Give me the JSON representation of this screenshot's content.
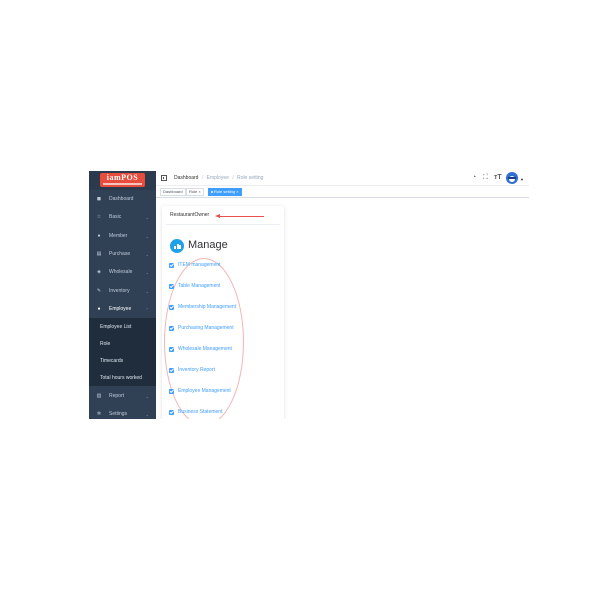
{
  "brand": {
    "logo_text": "iamPOS",
    "logo_color": "#e74c3c"
  },
  "sidebar": {
    "background": "#304156",
    "items": [
      {
        "label": "Dashboard",
        "icon": "dashboard-icon",
        "glyph": "◼",
        "arrow": ""
      },
      {
        "label": "Basic",
        "icon": "star-icon",
        "glyph": "☆",
        "arrow": "⌄"
      },
      {
        "label": "Member",
        "icon": "user-icon",
        "glyph": "●",
        "arrow": "⌄"
      },
      {
        "label": "Purchase",
        "icon": "list-icon",
        "glyph": "▤",
        "arrow": "⌄"
      },
      {
        "label": "Wholesale",
        "icon": "tag-icon",
        "glyph": "◈",
        "arrow": "⌄"
      },
      {
        "label": "Inventory",
        "icon": "edit-icon",
        "glyph": "✎",
        "arrow": "⌄"
      },
      {
        "label": "Employee",
        "icon": "employee-icon",
        "glyph": "●",
        "arrow": "⌃"
      },
      {
        "label": "Report",
        "icon": "chart-icon",
        "glyph": "▥",
        "arrow": "⌄"
      },
      {
        "label": "Settings",
        "icon": "gear-icon",
        "glyph": "✲",
        "arrow": "⌄"
      }
    ],
    "employee_submenu": [
      "Employee List",
      "Role",
      "Timecards",
      "Total hours worked"
    ]
  },
  "navbar": {
    "breadcrumb": [
      "Dashboard",
      "Employee",
      "Role setting"
    ],
    "separator": "/",
    "icons": [
      "help-icon",
      "fullscreen-icon",
      "font-size-icon",
      "avatar"
    ]
  },
  "tags": [
    {
      "label": "Dashboard",
      "active": false
    },
    {
      "label": "Role ×",
      "active": false
    },
    {
      "label": "Role setting ×",
      "active": true
    }
  ],
  "role": {
    "name": "RestaurantOwner"
  },
  "section": {
    "title": "Manage",
    "icon": "bar-chart-icon",
    "icon_color": "#1da1e8"
  },
  "permissions": [
    {
      "label": "ITEM management",
      "checked": true
    },
    {
      "label": "Table Management",
      "checked": true
    },
    {
      "label": "Membership Management",
      "checked": true
    },
    {
      "label": "Purchasing Management",
      "checked": true
    },
    {
      "label": "Wholesale Management",
      "checked": true
    },
    {
      "label": "Inventory Report",
      "checked": true
    },
    {
      "label": "Employee Management",
      "checked": true
    },
    {
      "label": "Business Statement",
      "checked": true
    }
  ],
  "accent_color": "#409eff"
}
